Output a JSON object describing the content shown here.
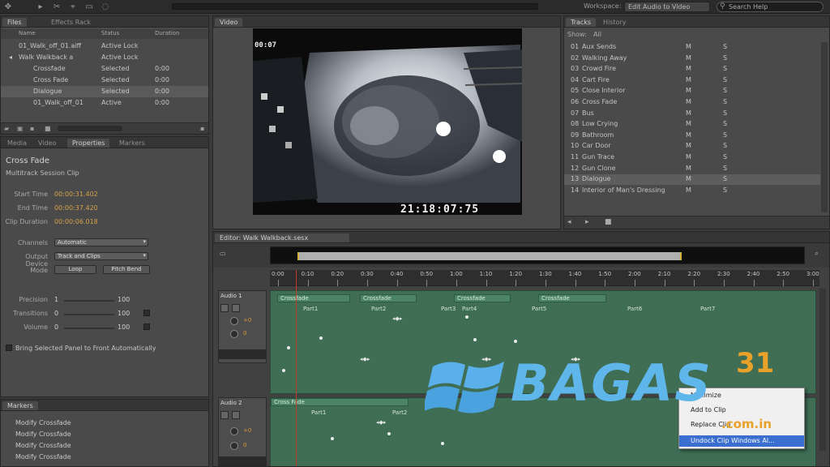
{
  "topbar": {
    "workspace_label": "Workspace:",
    "workspace_value": "Edit Audio to Video",
    "search_placeholder": "Search Help"
  },
  "files": {
    "tabs": [
      "Files",
      "Effects Rack"
    ],
    "columns": [
      "Name",
      "Status",
      "Duration"
    ],
    "rows": [
      {
        "name": "01_Walk_off_01.aiff",
        "status": "Active Lock",
        "duration": ""
      },
      {
        "name": "Walk Walkback a",
        "status": "Active Lock",
        "duration": ""
      },
      {
        "name": "Crossfade",
        "status": "Selected",
        "duration": "0:00"
      },
      {
        "name": "Cross Fade",
        "status": "Selected",
        "duration": "0:00"
      },
      {
        "name": "Dialogue",
        "status": "Selected",
        "duration": "0:00"
      },
      {
        "name": "01_Walk_off_01",
        "status": "Active",
        "duration": "0:00"
      }
    ]
  },
  "props": {
    "tabs": [
      "Media",
      "Video",
      "Properties",
      "Markers"
    ],
    "title": "Cross Fade",
    "subtitle": "Multitrack Session Clip",
    "fields": [
      {
        "label": "Start Time",
        "value": "00:00:31.402"
      },
      {
        "label": "End Time",
        "value": "00:00:37.420"
      },
      {
        "label": "Clip Duration",
        "value": "00:00:06.018"
      }
    ],
    "dropdowns": [
      {
        "label": "Channels",
        "value": "Automatic"
      },
      {
        "label": "Output Device",
        "value": "Track and Clips"
      }
    ],
    "mode_label": "Mode",
    "mode_buttons": [
      "Loop",
      "Pitch Bend"
    ],
    "sliders": [
      {
        "label": "Precision",
        "value": "1",
        "max": "100"
      },
      {
        "label": "Transitions",
        "value": "0",
        "max": "100"
      },
      {
        "label": "Volume",
        "value": "0",
        "max": "100"
      }
    ],
    "checkbox_label": "Bring Selected Panel to Front Automatically"
  },
  "markers": {
    "tab": "Markers",
    "items": [
      "Modify Crossfade",
      "Modify Crossfade",
      "Modify Crossfade",
      "Modify Crossfade",
      "Modify Crossfade"
    ]
  },
  "monitor": {
    "tabs": [
      "Video"
    ],
    "timecode_top": "00:07",
    "timecode_bottom": "21:18:07:75"
  },
  "tracks": {
    "tabs": [
      "Tracks",
      "History"
    ],
    "filter_label": "Show:",
    "filter_value": "All",
    "rows": [
      {
        "num": "01",
        "name": "Aux Sends",
        "c1": "M",
        "c2": "S"
      },
      {
        "num": "02",
        "name": "Walking Away",
        "c1": "M",
        "c2": "S"
      },
      {
        "num": "03",
        "name": "Crowd Fire",
        "c1": "M",
        "c2": "S"
      },
      {
        "num": "04",
        "name": "Cart Fire",
        "c1": "M",
        "c2": "S"
      },
      {
        "num": "05",
        "name": "Close Interior",
        "c1": "M",
        "c2": "S"
      },
      {
        "num": "06",
        "name": "Cross Fade",
        "c1": "M",
        "c2": "S"
      },
      {
        "num": "07",
        "name": "Bus",
        "c1": "M",
        "c2": "S"
      },
      {
        "num": "08",
        "name": "Low Crying",
        "c1": "M",
        "c2": "S"
      },
      {
        "num": "09",
        "name": "Bathroom",
        "c1": "M",
        "c2": "S"
      },
      {
        "num": "10",
        "name": "Car Door",
        "c1": "M",
        "c2": "S"
      },
      {
        "num": "11",
        "name": "Gun Trace",
        "c1": "M",
        "c2": "S"
      },
      {
        "num": "12",
        "name": "Gun Clone",
        "c1": "M",
        "c2": "S"
      },
      {
        "num": "13",
        "name": "Dialogue",
        "c1": "M",
        "c2": "S"
      },
      {
        "num": "14",
        "name": "Interior of Man's Dressing",
        "c1": "M",
        "c2": "S"
      }
    ]
  },
  "editor": {
    "tab": "Editor: Walk Walkback.sesx",
    "ruler": [
      "0:00",
      "0:10",
      "0:20",
      "0:30",
      "0:40",
      "0:50",
      "1:00",
      "1:10",
      "1:20",
      "1:30",
      "1:40",
      "1:50",
      "2:00",
      "2:10",
      "2:20",
      "2:30",
      "2:40",
      "2:50",
      "3:00"
    ],
    "tracks": [
      {
        "name": "Audio 1",
        "clips": [
          "Crossfade",
          "Crossfade",
          "Crossfade",
          "Crossfade"
        ],
        "labels": [
          "Part1",
          "Part2",
          "Part3",
          "Part4",
          "Part5",
          "Part6",
          "Part7"
        ]
      },
      {
        "name": "Audio 2",
        "clips": [
          "Cross Fade"
        ],
        "labels": [
          "Part1",
          "Part2"
        ]
      }
    ]
  },
  "context_menu": {
    "items": [
      "Maximize",
      "Add to Clip",
      "Replace Clip",
      "Undock Clip Windows Al..."
    ],
    "highlighted": 3
  },
  "watermark": {
    "brand": "BAGAS",
    "number": "31",
    "domain": ".com.in"
  }
}
